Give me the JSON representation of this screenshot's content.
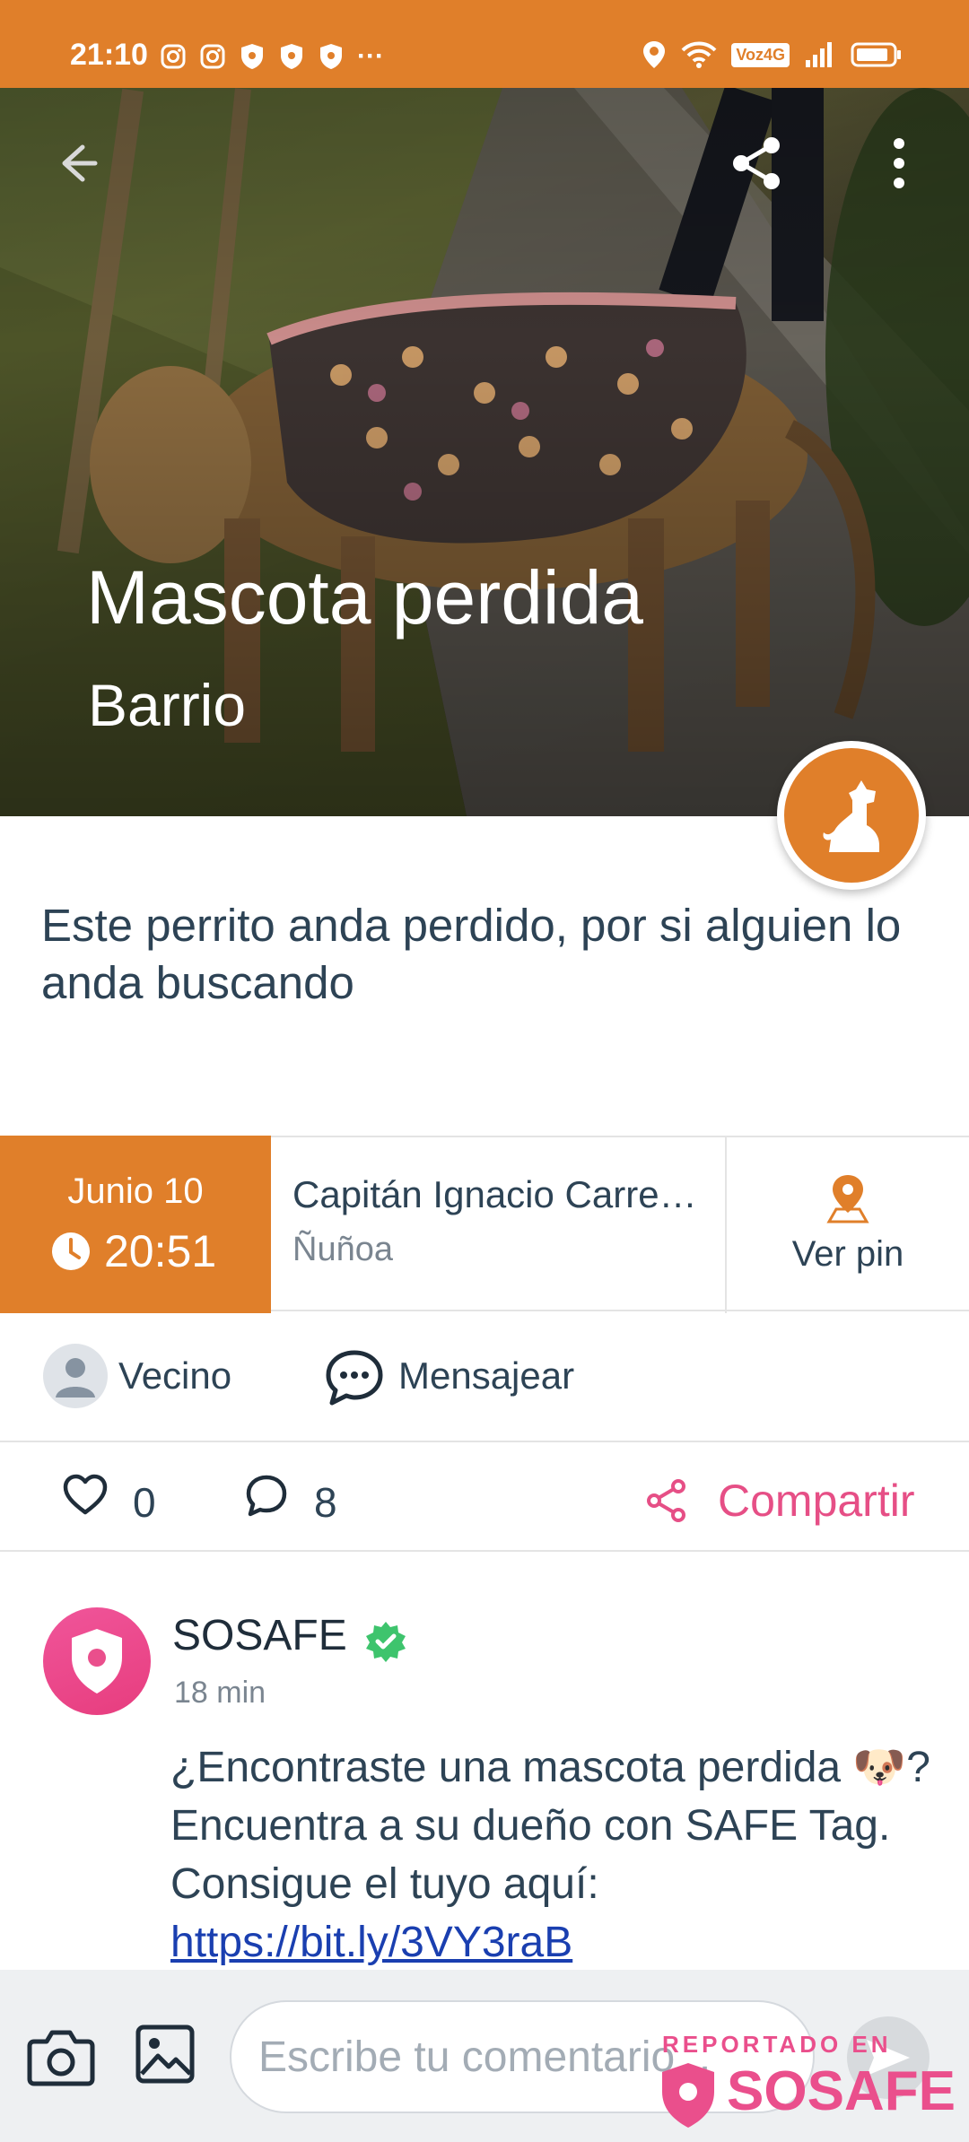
{
  "status_bar": {
    "time": "21:10",
    "carrier_badge": "Voz4G",
    "icons_left": [
      "instagram-icon",
      "instagram-icon",
      "shield-icon",
      "shield-icon",
      "shield-icon",
      "more-notifications-icon"
    ],
    "icons_right": [
      "location-icon",
      "wifi-icon",
      "volte-icon",
      "signal-icon",
      "battery-icon"
    ],
    "ellipsis": "···"
  },
  "post": {
    "title": "Mascota perdida",
    "subtitle": "Barrio",
    "category_icon": "dog-icon",
    "description": "Este perrito anda perdido, por si alguien lo anda buscando"
  },
  "info": {
    "date": "Junio 10",
    "time": "20:51",
    "street": "Capitán Ignacio Carrera Pinto",
    "commune": "Ñuñoa",
    "pin_label": "Ver pin"
  },
  "author": {
    "name": "Vecino",
    "message_label": "Mensajear"
  },
  "stats": {
    "likes": "0",
    "comments": "8",
    "share_label": "Compartir"
  },
  "comment": {
    "author": "SOSAFE",
    "time": "18 min",
    "text": "¿Encontraste una mascota perdida 🐶? Encuentra a su dueño con SAFE Tag. Consigue el tuyo aquí: ",
    "link": "https://bit.ly/3VY3raB"
  },
  "composer": {
    "placeholder": "Escribe tu comentario..."
  },
  "watermark": {
    "reported": "REPORTADO EN",
    "brand": "SOSAFE"
  },
  "colors": {
    "accent_orange": "#e07f2a",
    "pink": "#e64f86",
    "verified_green": "#3ec46d",
    "text_dark": "#2d4355"
  }
}
